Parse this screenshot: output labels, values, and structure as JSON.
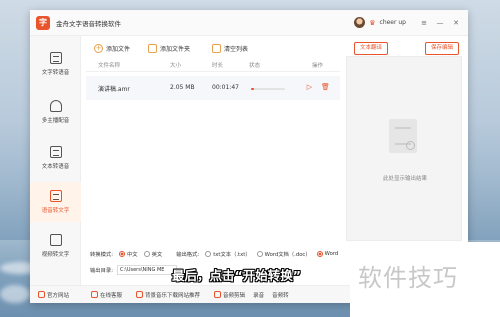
{
  "app": {
    "title": "金舟文字语音转换软件",
    "logo_glyph": "字"
  },
  "user": {
    "name": "cheer up"
  },
  "window_controls": {
    "menu": "≡",
    "minimize": "—",
    "close": "✕"
  },
  "sidebar": {
    "items": [
      {
        "label": "文字转语音",
        "icon": "text-to-speech-icon"
      },
      {
        "label": "多主播配音",
        "icon": "multi-voice-icon"
      },
      {
        "label": "文本转语音",
        "icon": "doc-to-speech-icon"
      },
      {
        "label": "语音转文字",
        "icon": "speech-to-text-icon",
        "active": true
      },
      {
        "label": "视频转文字",
        "icon": "video-to-text-icon"
      }
    ]
  },
  "toolbar": {
    "add_file": "添加文件",
    "add_folder": "添加文件夹",
    "clear_list": "清空列表",
    "text_translate": "文本翻译",
    "save_edit": "保存编辑"
  },
  "table": {
    "headers": [
      "文件名称",
      "大小",
      "时长",
      "状态",
      "操作"
    ],
    "rows": [
      {
        "name": "演讲稿.amr",
        "size": "2.05 MB",
        "duration": "00:01:47",
        "progress": 0.1
      }
    ]
  },
  "preview": {
    "placeholder": "此处显示输出结果"
  },
  "settings": {
    "mode_label": "转换模式:",
    "modes": [
      "中文",
      "英文"
    ],
    "mode_selected": "中文",
    "format_label": "输出格式:",
    "formats": [
      "txt文本（.txt）",
      "Word文档（.doc）",
      "Word"
    ],
    "format_selected": "Word",
    "dir_label": "输出目录:",
    "dir_value": "C:\\Users\\NING ME"
  },
  "statusbar": {
    "items": [
      "官方网站",
      "在线客服",
      "背景音乐下载网站推荐",
      "音频剪辑",
      "录音",
      "音频转"
    ]
  },
  "overlay": {
    "caption": "最后，点击“开始转换”",
    "watermark": "软件技巧"
  },
  "colors": {
    "accent": "#e8542b",
    "muted_text": "#888888"
  }
}
